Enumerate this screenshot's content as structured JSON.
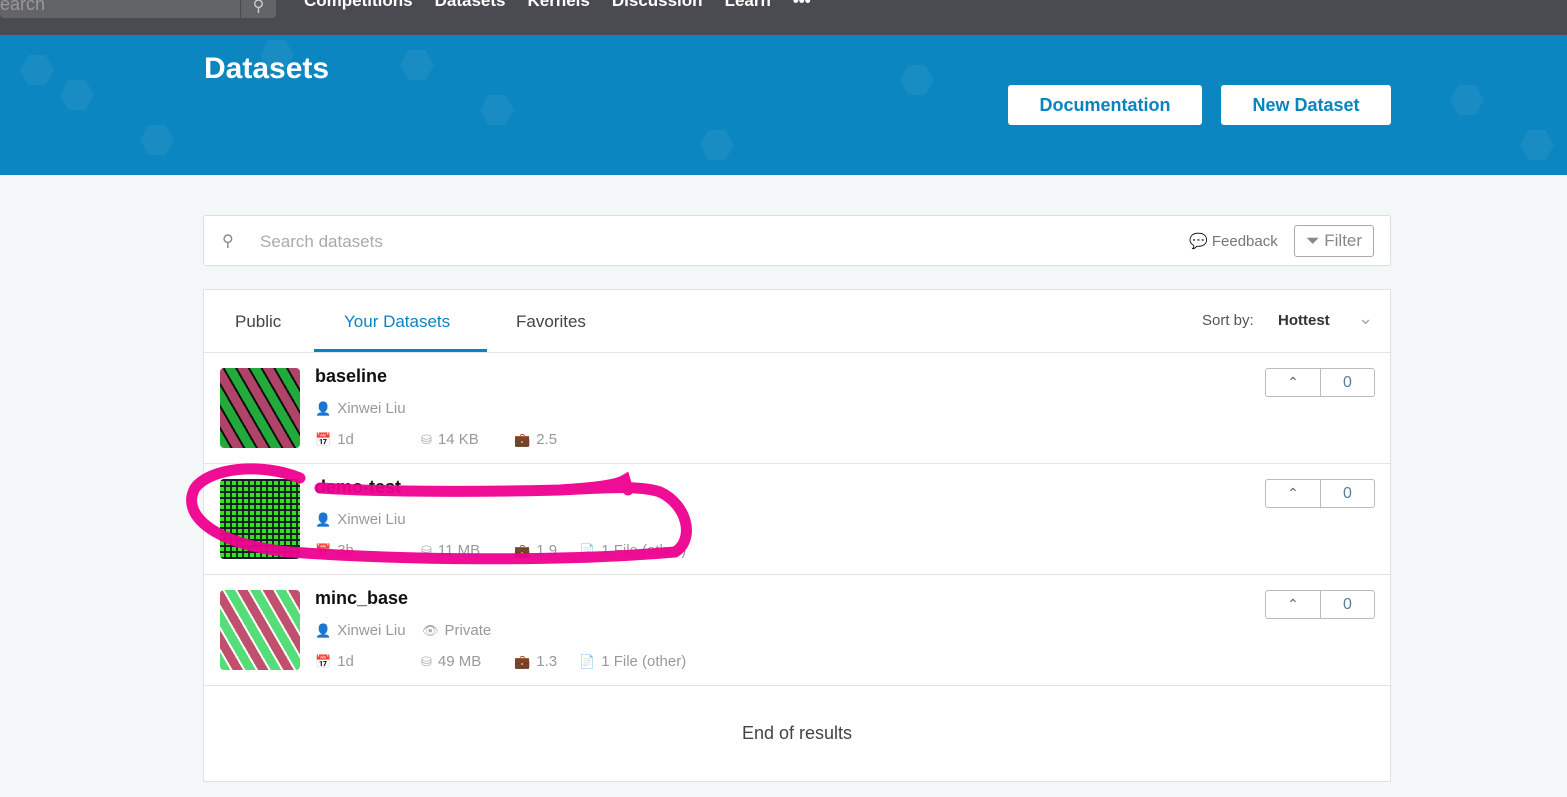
{
  "topbar": {
    "search_placeholder": "Search",
    "nav": [
      "Competitions",
      "Datasets",
      "Kernels",
      "Discussion",
      "Learn",
      "•••"
    ]
  },
  "header": {
    "title": "Datasets",
    "documentation": "Documentation",
    "new_dataset": "New Dataset"
  },
  "search": {
    "placeholder": "Search datasets",
    "feedback": "Feedback",
    "filter": "Filter"
  },
  "tabs": [
    {
      "label": "Public"
    },
    {
      "label": "Your Datasets",
      "active": true
    },
    {
      "label": "Favorites"
    }
  ],
  "sort": {
    "label": "Sort by:",
    "value": "Hottest"
  },
  "datasets": [
    {
      "name": "baseline",
      "owner": "Xinwei Liu",
      "age": "1d",
      "size": "14 KB",
      "score": "2.5",
      "votes": "0"
    },
    {
      "name": "demo-test",
      "owner": "Xinwei Liu",
      "age": "3h",
      "size": "11 MB",
      "score": "1.9",
      "files": "1 File (other)",
      "votes": "0"
    },
    {
      "name": "minc_base",
      "owner": "Xinwei Liu",
      "visibility": "Private",
      "age": "1d",
      "size": "49 MB",
      "score": "1.3",
      "files": "1 File (other)",
      "votes": "0"
    }
  ],
  "end_text": "End of results",
  "colors": {
    "accent": "#0a84c0",
    "annotation": "#ee0090"
  }
}
